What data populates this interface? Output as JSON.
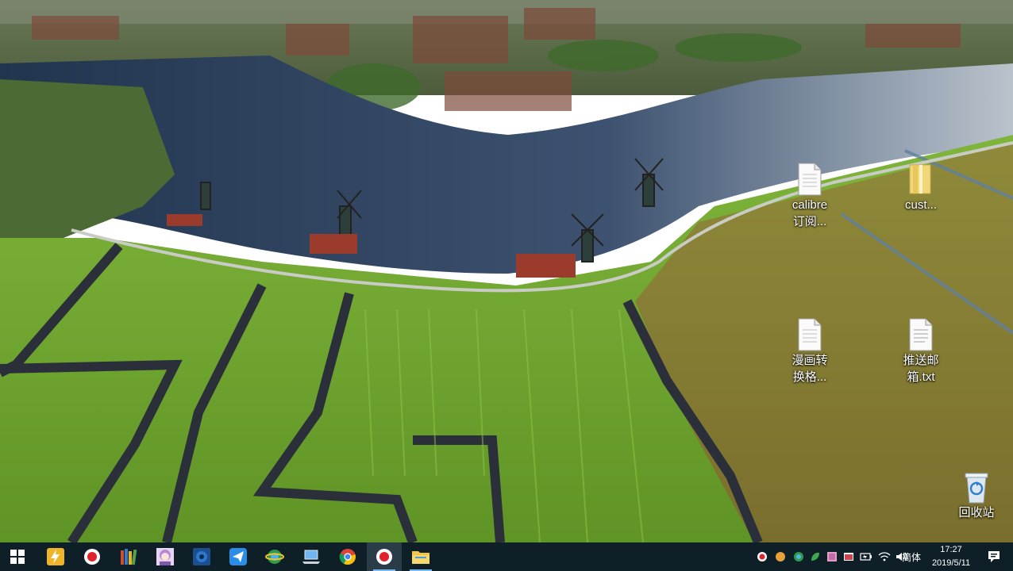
{
  "desktop": {
    "icons": [
      {
        "label_line1": "calibre",
        "label_line2": "订阅...",
        "type": "document"
      },
      {
        "label_line1": "cust...",
        "label_line2": "",
        "type": "folder"
      },
      {
        "label_line1": "漫画转",
        "label_line2": "换格...",
        "type": "document"
      },
      {
        "label_line1": "推送邮",
        "label_line2": "箱.txt",
        "type": "text-file"
      },
      {
        "label_line1": "回收站",
        "label_line2": "",
        "type": "recycle-bin"
      }
    ]
  },
  "taskbar": {
    "pinned": [
      "start-windows-icon",
      "thunder-icon",
      "record-icon",
      "library-books-icon",
      "anime-avatar-icon",
      "photoshop-like-icon",
      "paper-plane-icon",
      "browser-globe-icon",
      "laptop-icon",
      "chrome-icon",
      "record-active-icon",
      "file-explorer-icon"
    ],
    "tray": {
      "ime_label": "简体",
      "time": "17:27",
      "date": "2019/5/11"
    }
  },
  "colors": {
    "taskbar_bg": "#0f1f28",
    "water": "#2a3f5c",
    "field": "#6fa32c",
    "accent": "#76b9ed"
  }
}
